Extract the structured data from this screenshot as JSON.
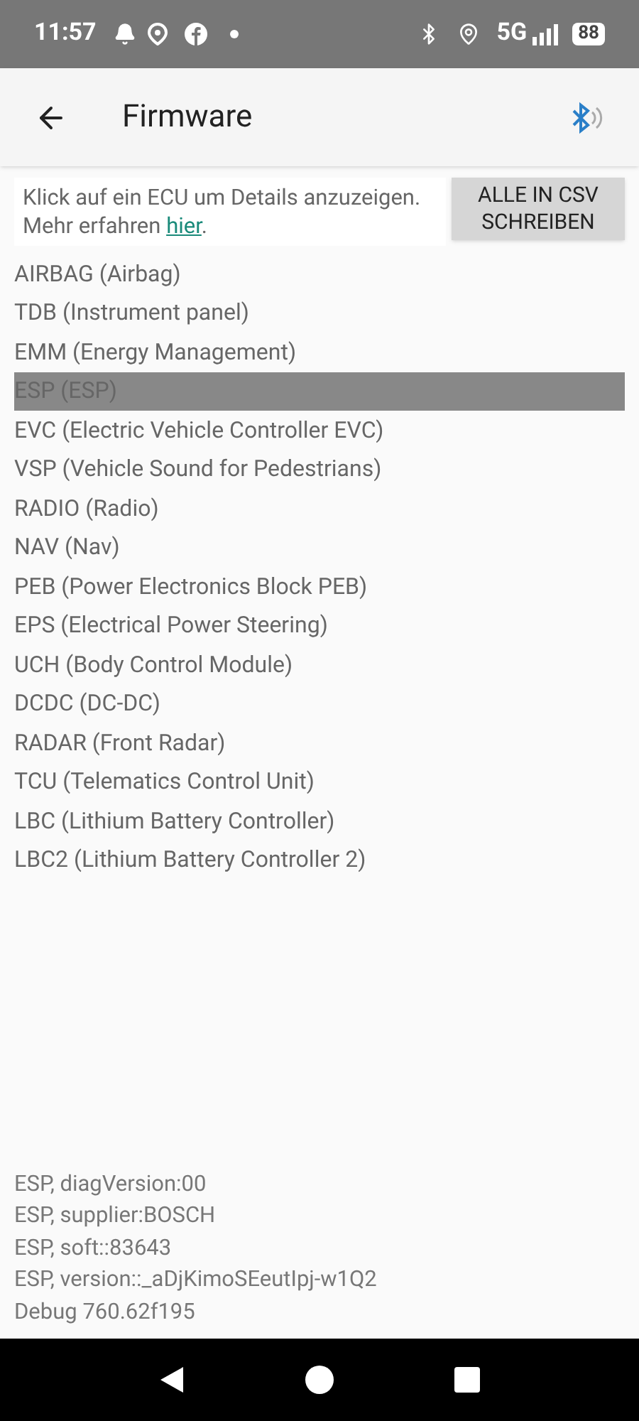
{
  "status_bar": {
    "time": "11:57",
    "network": "5G",
    "battery": "88"
  },
  "app_bar": {
    "title": "Firmware"
  },
  "info": {
    "text": "Klick auf ein ECU um Details anzuzeigen. Mehr erfahren ",
    "link": "hier",
    "after": "."
  },
  "export_button": "ALLE IN CSV SCHREIBEN",
  "ecus": [
    {
      "label": "AIRBAG (Airbag)",
      "selected": false
    },
    {
      "label": "TDB (Instrument panel)",
      "selected": false
    },
    {
      "label": "EMM (Energy Management)",
      "selected": false
    },
    {
      "label": "ESP (ESP)",
      "selected": true
    },
    {
      "label": "EVC (Electric Vehicle Controller EVC)",
      "selected": false
    },
    {
      "label": "VSP (Vehicle Sound for Pedestrians)",
      "selected": false
    },
    {
      "label": "RADIO (Radio)",
      "selected": false
    },
    {
      "label": "NAV (Nav)",
      "selected": false
    },
    {
      "label": "PEB (Power Electronics Block PEB)",
      "selected": false
    },
    {
      "label": "EPS (Electrical Power Steering)",
      "selected": false
    },
    {
      "label": "UCH (Body Control Module)",
      "selected": false
    },
    {
      "label": "DCDC (DC-DC)",
      "selected": false
    },
    {
      "label": "RADAR (Front Radar)",
      "selected": false
    },
    {
      "label": "TCU (Telematics Control Unit)",
      "selected": false
    },
    {
      "label": "LBC (Lithium Battery Controller)",
      "selected": false
    },
    {
      "label": "LBC2 (Lithium Battery Controller 2)",
      "selected": false
    }
  ],
  "details": [
    "ESP, diagVersion:00",
    "ESP, supplier:BOSCH",
    "ESP, soft::83643",
    "ESP, version::_aDjKimoSEeutIpj-w1Q2",
    "Debug 760.62f195"
  ]
}
